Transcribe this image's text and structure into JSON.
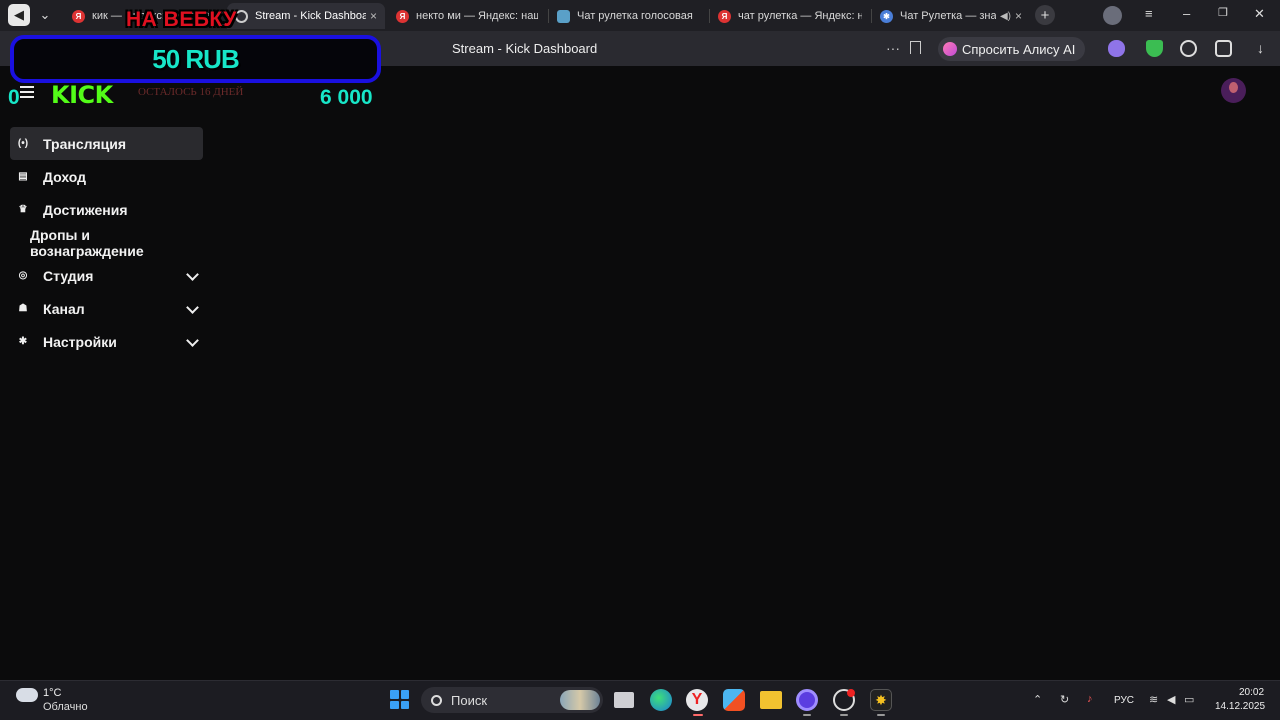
{
  "browser": {
    "tabs": [
      {
        "title": "кик — Яндекс: нашлось",
        "favicon": "yandex-icon",
        "active": false
      },
      {
        "title": "Stream - Kick Dashboard",
        "favicon": "loading-icon",
        "active": true,
        "close": "×"
      },
      {
        "title": "некто ми — Яндекс: нашлось",
        "favicon": "yandex-icon",
        "active": false
      },
      {
        "title": "Чат рулетка голосовая",
        "favicon": "chat-icon",
        "active": false
      },
      {
        "title": "чат рулетка — Яндекс: нашлось",
        "favicon": "yandex-icon",
        "active": false
      },
      {
        "title": "Чат Рулетка — знакомства",
        "favicon": "gear-favicon",
        "active": false
      }
    ],
    "page_title": "Stream - Kick Dashboard",
    "ask_alice_label": "Спросить Алису AI",
    "new_tab_label": "+",
    "menu_label": "≡",
    "minimize_label": "–",
    "restore_label": "❐",
    "close_label": "✕",
    "more_label": "···"
  },
  "overlay": {
    "title": "НА ВЕБКУ",
    "amount": "50 RUB",
    "remaining": "ОСТАЛОСЬ 16 ДНЕЙ",
    "goal_start": "0",
    "goal_target": "6 000"
  },
  "kick": {
    "logo": "KICK"
  },
  "sidebar": {
    "items": [
      {
        "label": "Трансляция",
        "icon": "broadcast-icon",
        "glyph": "(•)",
        "active": true,
        "expandable": false
      },
      {
        "label": "Доход",
        "icon": "chart-icon",
        "glyph": "▤",
        "active": false,
        "expandable": false
      },
      {
        "label": "Достижения",
        "icon": "trophy-icon",
        "glyph": "♛",
        "active": false,
        "expandable": false
      },
      {
        "label": "Дропы и вознаграждение",
        "icon": "",
        "glyph": "",
        "active": false,
        "expandable": false
      },
      {
        "label": "Студия",
        "icon": "studio-icon",
        "glyph": "◎",
        "active": false,
        "expandable": true
      },
      {
        "label": "Канал",
        "icon": "channel-icon",
        "glyph": "☗",
        "active": false,
        "expandable": true
      },
      {
        "label": "Настройки",
        "icon": "settings-icon",
        "glyph": "✱",
        "active": false,
        "expandable": true
      }
    ]
  },
  "taskbar": {
    "weather_temp": "1°C",
    "weather_desc": "Облачно",
    "search_placeholder": "Поиск",
    "language": "РУС",
    "time": "20:02",
    "date": "14.12.2025"
  },
  "colors": {
    "accent_green": "#53fc18",
    "goal_teal": "#17e6c8",
    "overlay_border": "#1a10e0",
    "overlay_title": "#e01020"
  }
}
